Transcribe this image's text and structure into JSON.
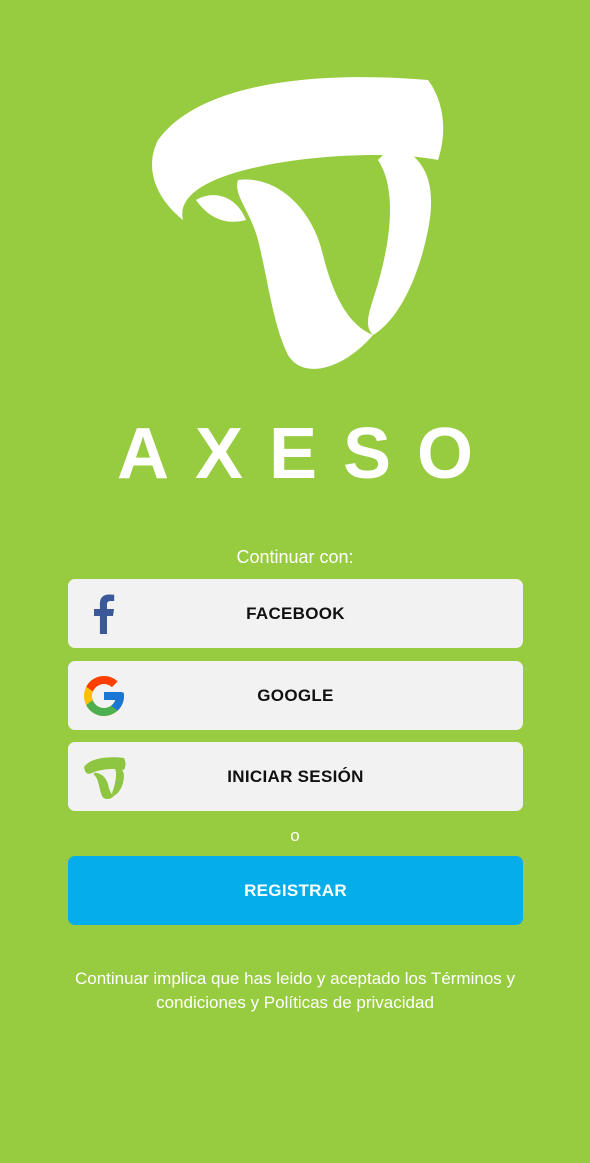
{
  "brand": {
    "name": "AXESO",
    "logo_icon": "axeso-logo-icon"
  },
  "auth": {
    "continue_label": "Continuar con:",
    "facebook_label": "FACEBOOK",
    "google_label": "GOOGLE",
    "login_label": "INICIAR SESIÓN",
    "or_label": "o",
    "register_label": "REGISTRAR"
  },
  "legal": {
    "terms_text": "Continuar implica que has leido y aceptado los Términos y condiciones y Políticas de privacidad"
  },
  "colors": {
    "background": "#97cb40",
    "button_bg": "#f2f2f2",
    "register_bg": "#05aeea",
    "text_light": "#ffffff",
    "facebook_blue": "#3b5998"
  }
}
